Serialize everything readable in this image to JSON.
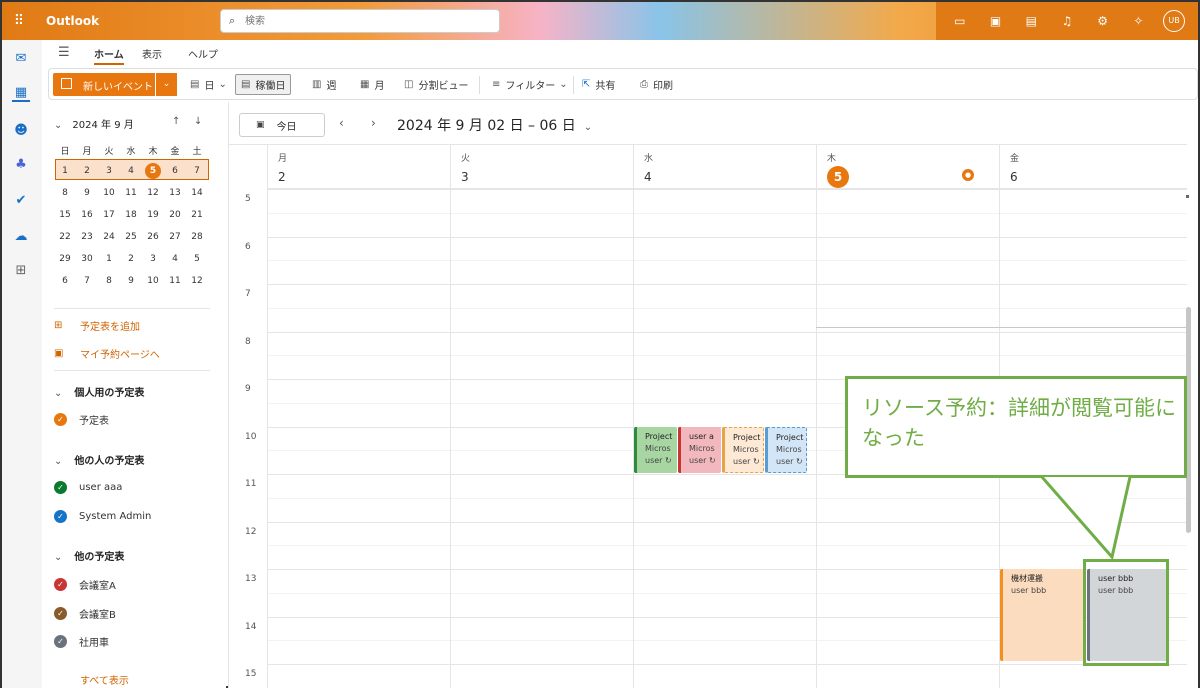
{
  "app": {
    "name": "Outlook"
  },
  "search": {
    "placeholder": "検索"
  },
  "topbar": {
    "avatar": "UB",
    "icons": [
      "meet-now-icon",
      "forms-icon",
      "whiteboard-icon",
      "bell-icon",
      "gear-icon",
      "lightbulb-icon"
    ]
  },
  "menu": {
    "tabs": [
      "ホーム",
      "表示",
      "ヘルプ"
    ]
  },
  "ribbon": {
    "new_event": "新しいイベント",
    "day": "日",
    "workweek": "稼働日",
    "week": "週",
    "month": "月",
    "split": "分割ビュー",
    "filter": "フィルター",
    "share": "共有",
    "print": "印刷"
  },
  "minical": {
    "title": "2024 年 9 月",
    "weekdays": [
      "日",
      "月",
      "火",
      "水",
      "木",
      "金",
      "土"
    ],
    "weeks": [
      [
        "1",
        "2",
        "3",
        "4",
        "5",
        "6",
        "7"
      ],
      [
        "8",
        "9",
        "10",
        "11",
        "12",
        "13",
        "14"
      ],
      [
        "15",
        "16",
        "17",
        "18",
        "19",
        "20",
        "21"
      ],
      [
        "22",
        "23",
        "24",
        "25",
        "26",
        "27",
        "28"
      ],
      [
        "29",
        "30",
        "1",
        "2",
        "3",
        "4",
        "5"
      ],
      [
        "6",
        "7",
        "8",
        "9",
        "10",
        "11",
        "12"
      ]
    ],
    "today": "5"
  },
  "sidebar": {
    "add_calendar": "予定表を追加",
    "booking": "マイ予約ページへ",
    "groups": [
      {
        "label": "個人用の予定表",
        "items": [
          {
            "name": "予定表",
            "color": "#e8770f"
          }
        ]
      },
      {
        "label": "他の人の予定表",
        "items": [
          {
            "name": "user aaa",
            "color": "#0b7a2e"
          },
          {
            "name": "System Admin",
            "color": "#1574c8"
          }
        ]
      },
      {
        "label": "他の予定表",
        "items": [
          {
            "name": "会議室A",
            "color": "#c73535"
          },
          {
            "name": "会議室B",
            "color": "#8a5b2a"
          },
          {
            "name": "社用車",
            "color": "#69727d"
          }
        ]
      }
    ],
    "show_all": "すべて表示"
  },
  "main": {
    "today_button": "今日",
    "range": "2024 年 9 月 02 日 – 06 日",
    "days": [
      {
        "name": "月",
        "date": "2"
      },
      {
        "name": "火",
        "date": "3"
      },
      {
        "name": "水",
        "date": "4"
      },
      {
        "name": "木",
        "date": "5",
        "today": true
      },
      {
        "name": "金",
        "date": "6"
      }
    ],
    "hours": [
      "5",
      "6",
      "7",
      "8",
      "9",
      "10",
      "11",
      "12",
      "13",
      "14",
      "15"
    ]
  },
  "events": [
    {
      "title": "Project",
      "line2": "Micros",
      "line3": "user ↻",
      "bg": "#a7d6a3",
      "bar": "#2e8b3d"
    },
    {
      "title": "user a",
      "line2": "Micros",
      "line3": "user ↻",
      "bg": "#f2b8bd",
      "bar": "#c73535"
    },
    {
      "title": "Project",
      "line2": "Micros",
      "line3": "user ↻",
      "bg": "#fde9d4",
      "bar": "#e8a34a"
    },
    {
      "title": "Project",
      "line2": "Micros",
      "line3": "user ↻",
      "bg": "#d3e6f7",
      "bar": "#5a9bd4"
    },
    {
      "title": "機材運搬",
      "line2": "user bbb",
      "bg": "#fcdcbf",
      "bar": "#f0901e"
    },
    {
      "title": "user bbb",
      "line2": "user bbb",
      "bg": "#d2d6d9",
      "bar": "#69727d"
    }
  ],
  "callout": {
    "text": "リソース予約：詳細が閲覧可能になった"
  }
}
